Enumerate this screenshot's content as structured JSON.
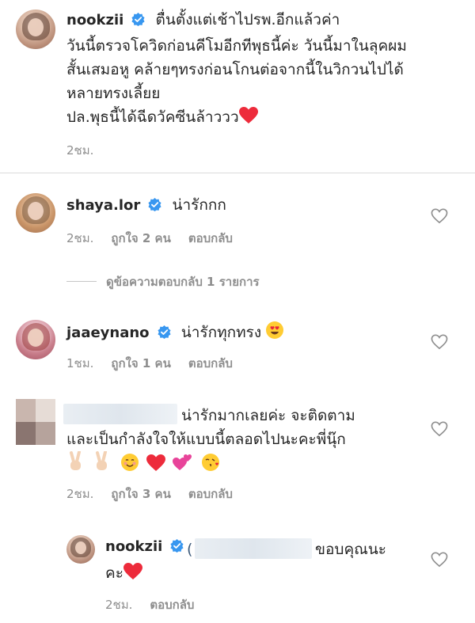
{
  "caption": {
    "username": "nookzii",
    "lines": [
      "ตื่นตั้งแต่เช้าไปรพ.อีกแล้วค่า",
      "วันนี้ตรวจโควิดก่อนคีโมอีกทีพุธนี้ค่ะ วันนี้มาในลุคผม",
      "สั้นเสมอหู คล้ายๆทรงก่อนโกนต่อจากนี้ในวิกวนไปได้",
      "หลายทรงเลี้ยย",
      "ปล.พุธนี้ได้ฉีดวัคซีนล้าววว"
    ],
    "time": "2ชม."
  },
  "comments": [
    {
      "username": "shaya.lor",
      "text": "น่ารักกก",
      "time": "2ชม.",
      "likes": "ถูกใจ 2 คน",
      "reply": "ตอบกลับ"
    },
    {
      "username": "jaaeynano",
      "text": "น่ารักทุกทรง",
      "time": "1ชม.",
      "likes": "ถูกใจ 1 คน",
      "reply": "ตอบกลับ"
    },
    {
      "username": "",
      "lines": [
        "น่ารักมากเลยค่ะ  จะติดตาม",
        "และเป็นกำลังใจให้แบบนี้ตลอดไปนะคะพี่นุ๊ก"
      ],
      "time": "2ชม.",
      "likes": "ถูกใจ 3 คน",
      "reply": "ตอบกลับ"
    }
  ],
  "view_replies": "ดูข้อความตอบกลับ 1 รายการ",
  "reply": {
    "username": "nookzii",
    "text_after_mention": "ขอบคุณนะ",
    "text_line2": "คะ",
    "time": "2ชม.",
    "reply": "ตอบกลับ"
  },
  "colors": {
    "text": "#262626",
    "meta": "#8e8e8e",
    "verified": "#3897f0",
    "heart": "#ed2b3b"
  }
}
